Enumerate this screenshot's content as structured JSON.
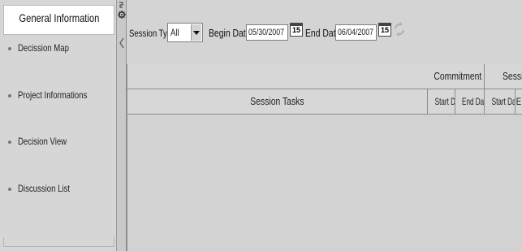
{
  "sidebar": {
    "header": "General Information",
    "items": [
      {
        "label": "Decission Map"
      },
      {
        "label": "Project Informations"
      },
      {
        "label": "Decision View"
      },
      {
        "label": "Discussion List"
      }
    ]
  },
  "toolbar": {
    "session_type_label": "Session Type",
    "session_type_value": "All",
    "begin_date_label": "Begin Date",
    "begin_date_value": "05/30/2007",
    "end_date_label": "End Date",
    "end_date_value": "06/04/2007",
    "calendar_icon_text": "15"
  },
  "grid": {
    "session_tasks_header": "Session Tasks",
    "groups": [
      {
        "label": "Commitment",
        "columns": [
          "Start Date",
          "End Date"
        ]
      },
      {
        "label": "Sessi",
        "columns": [
          "Start Date",
          "E"
        ]
      }
    ]
  },
  "icons": {
    "splitter": "gear-icon",
    "collapse": "chevron-left-icon",
    "calendar": "calendar-icon",
    "refresh": "refresh-icon"
  },
  "colors": {
    "panel": "#d4d4d4",
    "header_bg": "#ffffff",
    "border": "#8c8c8c"
  }
}
